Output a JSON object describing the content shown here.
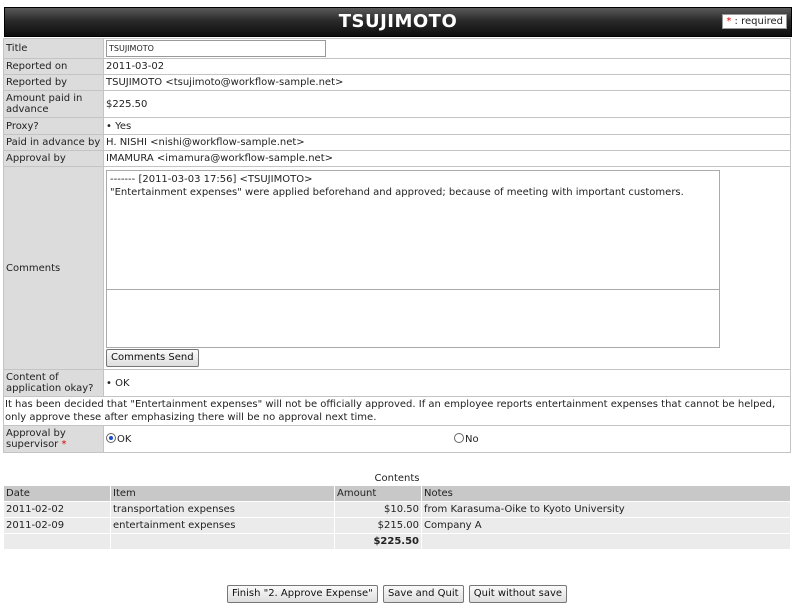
{
  "header": {
    "title": "TSUJIMOTO",
    "required_star": "*",
    "required_text": ": required"
  },
  "form": {
    "title_label": "Title",
    "title_value": "TSUJIMOTO",
    "reported_on_label": "Reported on",
    "reported_on_value": "2011-03-02",
    "reported_by_label": "Reported by",
    "reported_by_value": "TSUJIMOTO <tsujimoto@workflow-sample.net>",
    "amount_label": "Amount paid in advance",
    "amount_value": "$225.50",
    "proxy_label": "Proxy?",
    "proxy_value": "Yes",
    "paid_by_label": "Paid in advance by",
    "paid_by_value": "H. NISHI <nishi@workflow-sample.net>",
    "approval_by_label": "Approval by",
    "approval_by_value": "IMAMURA <imamura@workflow-sample.net>",
    "comments_label": "Comments",
    "comments_log_header": "------- [2011-03-03 17:56] <TSUJIMOTO>",
    "comments_log_body": "\"Entertainment expenses\" were applied beforehand and approved; because of meeting with important customers.",
    "comments_input_value": "",
    "comments_send_label": "Comments Send",
    "content_ok_label": "Content of application okay?",
    "content_ok_value": "OK",
    "notice": "It has been decided that \"Entertainment expenses\" will not be officially approved. If an employee reports entertainment expenses that cannot be helped, only approve these after emphasizing there will be no approval next time.",
    "supervisor_label": "Approval by supervisor",
    "supervisor_star": "*",
    "opt_ok": "OK",
    "opt_no": "No",
    "selected": "OK"
  },
  "contents": {
    "title": "Contents",
    "columns": [
      "Date",
      "Item",
      "Amount",
      "Notes"
    ],
    "rows": [
      {
        "date": "2011-02-02",
        "item": "transportation expenses",
        "amount": "$10.50",
        "notes": "from Karasuma-Oike to Kyoto University"
      },
      {
        "date": "2011-02-09",
        "item": "entertainment expenses",
        "amount": "$215.00",
        "notes": "Company A"
      }
    ],
    "total": "$225.50"
  },
  "actions": {
    "finish": "Finish \"2. Approve Expense\"",
    "save_quit": "Save and Quit",
    "quit_no_save": "Quit without save"
  },
  "colors": {
    "required_marker": "#e00000",
    "radio_selected": "#1a4dcc",
    "label_bg": "#dcdcdc",
    "header_bg": "#1a1a1a"
  }
}
